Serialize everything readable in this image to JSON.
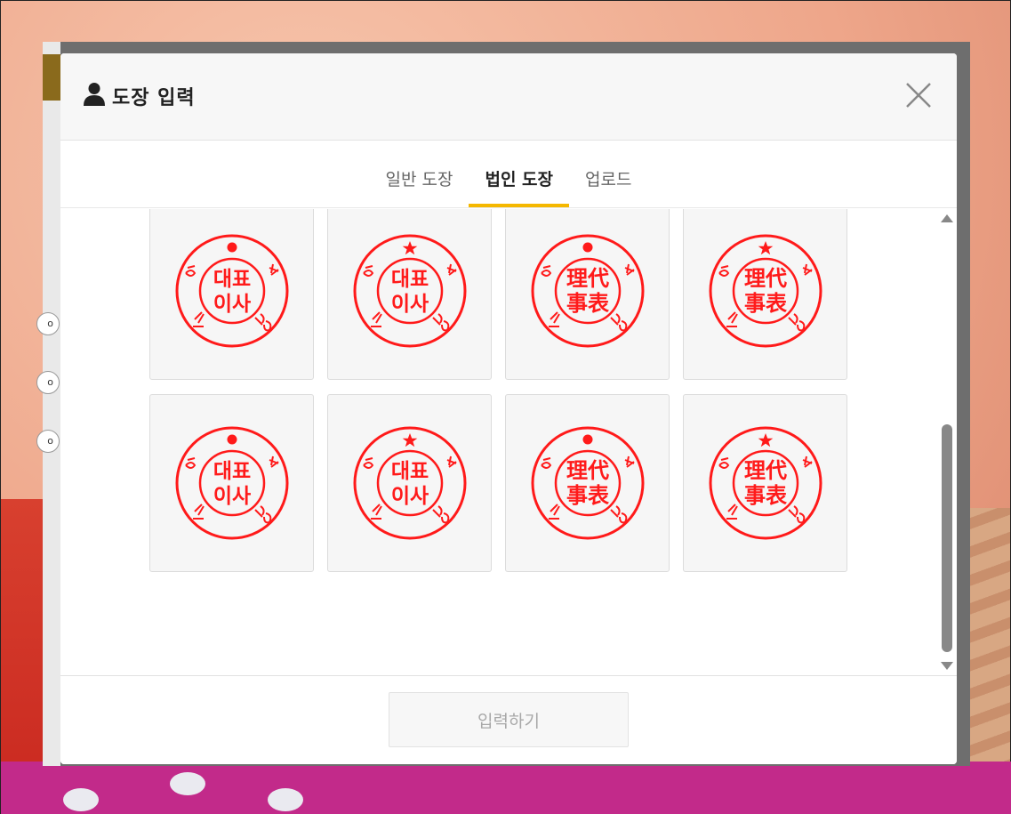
{
  "modal": {
    "title": "도장 입력",
    "title_icon": "user-icon",
    "close_icon": "close-icon",
    "submit_label": "입력하기"
  },
  "tabs": [
    {
      "label": "일반 도장",
      "active": false
    },
    {
      "label": "법인 도장",
      "active": true
    },
    {
      "label": "업로드",
      "active": false
    }
  ],
  "stamps": [
    {
      "variant": "dot",
      "top": "대표",
      "bottom": "이사",
      "hanja": false
    },
    {
      "variant": "star",
      "top": "대표",
      "bottom": "이사",
      "hanja": false
    },
    {
      "variant": "dot",
      "top": "理代",
      "bottom": "事表",
      "hanja": true
    },
    {
      "variant": "star",
      "top": "理代",
      "bottom": "事表",
      "hanja": true
    },
    {
      "variant": "dot",
      "top": "대표",
      "bottom": "이사",
      "hanja": false
    },
    {
      "variant": "star",
      "top": "대표",
      "bottom": "이사",
      "hanja": false
    },
    {
      "variant": "dot",
      "top": "理代",
      "bottom": "事表",
      "hanja": true
    },
    {
      "variant": "star",
      "top": "理代",
      "bottom": "事表",
      "hanja": true
    }
  ],
  "colors": {
    "stamp_red": "#ff1a1a",
    "tab_accent": "#f5b800",
    "overlay_gray": "#6e6e6e"
  },
  "background": {
    "badges": [
      "o",
      "o",
      "o"
    ]
  }
}
